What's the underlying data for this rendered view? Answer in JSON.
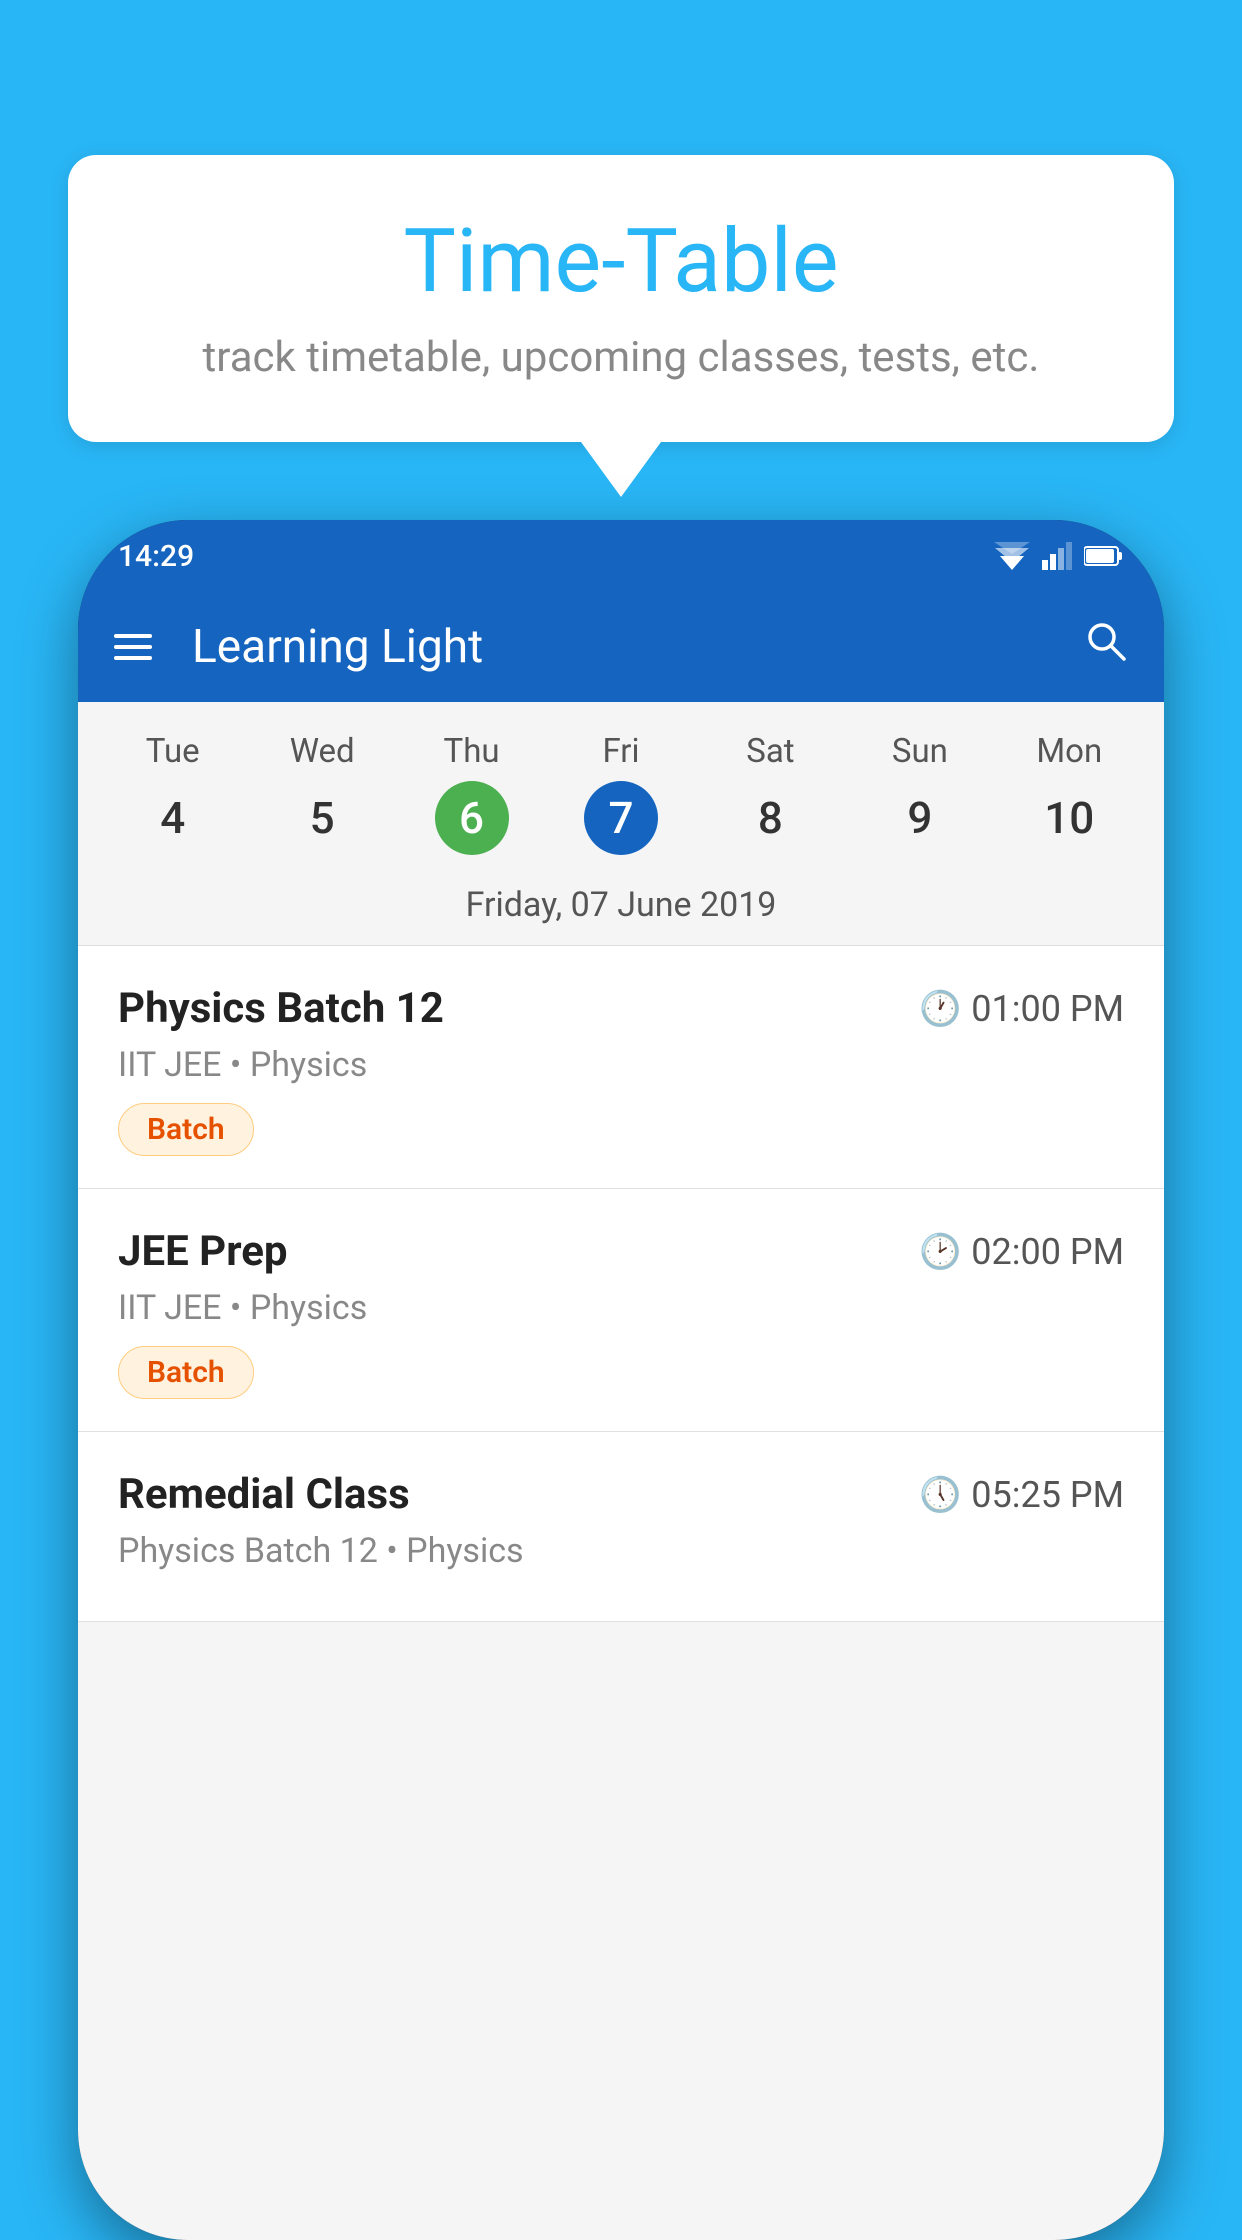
{
  "background_color": "#29B6F6",
  "speech_bubble": {
    "title": "Time-Table",
    "subtitle": "track timetable, upcoming classes, tests, etc."
  },
  "phone": {
    "status_bar": {
      "time": "14:29"
    },
    "app_bar": {
      "title": "Learning Light"
    },
    "calendar": {
      "days": [
        {
          "name": "Tue",
          "num": "4",
          "state": "normal"
        },
        {
          "name": "Wed",
          "num": "5",
          "state": "normal"
        },
        {
          "name": "Thu",
          "num": "6",
          "state": "today"
        },
        {
          "name": "Fri",
          "num": "7",
          "state": "selected"
        },
        {
          "name": "Sat",
          "num": "8",
          "state": "normal"
        },
        {
          "name": "Sun",
          "num": "9",
          "state": "normal"
        },
        {
          "name": "Mon",
          "num": "10",
          "state": "normal"
        }
      ],
      "selected_date_label": "Friday, 07 June 2019"
    },
    "schedule": [
      {
        "title": "Physics Batch 12",
        "time": "01:00 PM",
        "meta": "IIT JEE • Physics",
        "badge": "Batch"
      },
      {
        "title": "JEE Prep",
        "time": "02:00 PM",
        "meta": "IIT JEE • Physics",
        "badge": "Batch"
      },
      {
        "title": "Remedial Class",
        "time": "05:25 PM",
        "meta": "Physics Batch 12 • Physics",
        "badge": null
      }
    ]
  }
}
